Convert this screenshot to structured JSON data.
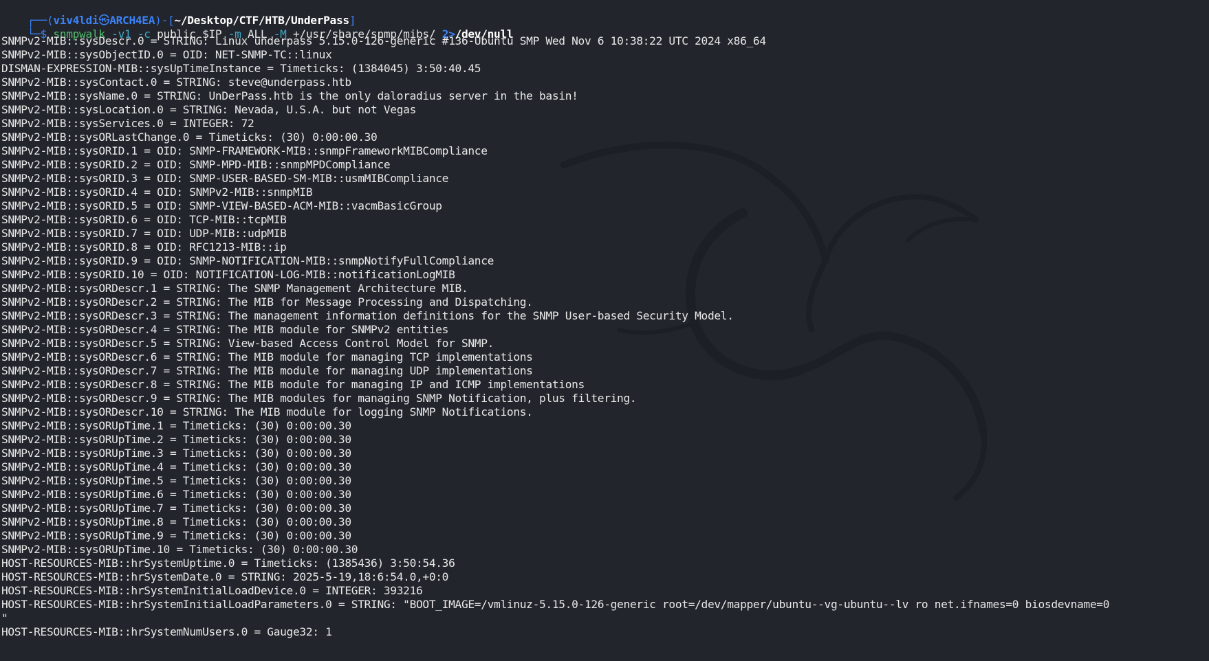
{
  "prompt": {
    "frame_open": "┌──(",
    "user": "viv4ldi",
    "skull": "㉿",
    "host": "ARCH4EA",
    "frame_mid": ")-[",
    "path": "~/Desktop/CTF/HTB/UnderPass",
    "frame_close": "]",
    "line2_prefix": "└─$ ",
    "command": {
      "name": "snmpwalk",
      "parts": [
        {
          "text": " ",
          "kind": "arg"
        },
        {
          "text": "-v1",
          "kind": "flag"
        },
        {
          "text": " ",
          "kind": "arg"
        },
        {
          "text": "-c",
          "kind": "flag"
        },
        {
          "text": " public $IP ",
          "kind": "arg"
        },
        {
          "text": "-m",
          "kind": "flag"
        },
        {
          "text": " ALL ",
          "kind": "arg"
        },
        {
          "text": "-M",
          "kind": "flag"
        },
        {
          "text": " +/usr/share/snmp/mibs/ ",
          "kind": "arg"
        },
        {
          "text": "2>",
          "kind": "redir"
        },
        {
          "text": "/dev/null",
          "kind": "target"
        }
      ]
    }
  },
  "output": [
    "SNMPv2-MIB::sysDescr.0 = STRING: Linux underpass 5.15.0-126-generic #136-Ubuntu SMP Wed Nov 6 10:38:22 UTC 2024 x86_64",
    "SNMPv2-MIB::sysObjectID.0 = OID: NET-SNMP-TC::linux",
    "DISMAN-EXPRESSION-MIB::sysUpTimeInstance = Timeticks: (1384045) 3:50:40.45",
    "SNMPv2-MIB::sysContact.0 = STRING: steve@underpass.htb",
    "SNMPv2-MIB::sysName.0 = STRING: UnDerPass.htb is the only daloradius server in the basin!",
    "SNMPv2-MIB::sysLocation.0 = STRING: Nevada, U.S.A. but not Vegas",
    "SNMPv2-MIB::sysServices.0 = INTEGER: 72",
    "SNMPv2-MIB::sysORLastChange.0 = Timeticks: (30) 0:00:00.30",
    "SNMPv2-MIB::sysORID.1 = OID: SNMP-FRAMEWORK-MIB::snmpFrameworkMIBCompliance",
    "SNMPv2-MIB::sysORID.2 = OID: SNMP-MPD-MIB::snmpMPDCompliance",
    "SNMPv2-MIB::sysORID.3 = OID: SNMP-USER-BASED-SM-MIB::usmMIBCompliance",
    "SNMPv2-MIB::sysORID.4 = OID: SNMPv2-MIB::snmpMIB",
    "SNMPv2-MIB::sysORID.5 = OID: SNMP-VIEW-BASED-ACM-MIB::vacmBasicGroup",
    "SNMPv2-MIB::sysORID.6 = OID: TCP-MIB::tcpMIB",
    "SNMPv2-MIB::sysORID.7 = OID: UDP-MIB::udpMIB",
    "SNMPv2-MIB::sysORID.8 = OID: RFC1213-MIB::ip",
    "SNMPv2-MIB::sysORID.9 = OID: SNMP-NOTIFICATION-MIB::snmpNotifyFullCompliance",
    "SNMPv2-MIB::sysORID.10 = OID: NOTIFICATION-LOG-MIB::notificationLogMIB",
    "SNMPv2-MIB::sysORDescr.1 = STRING: The SNMP Management Architecture MIB.",
    "SNMPv2-MIB::sysORDescr.2 = STRING: The MIB for Message Processing and Dispatching.",
    "SNMPv2-MIB::sysORDescr.3 = STRING: The management information definitions for the SNMP User-based Security Model.",
    "SNMPv2-MIB::sysORDescr.4 = STRING: The MIB module for SNMPv2 entities",
    "SNMPv2-MIB::sysORDescr.5 = STRING: View-based Access Control Model for SNMP.",
    "SNMPv2-MIB::sysORDescr.6 = STRING: The MIB module for managing TCP implementations",
    "SNMPv2-MIB::sysORDescr.7 = STRING: The MIB module for managing UDP implementations",
    "SNMPv2-MIB::sysORDescr.8 = STRING: The MIB module for managing IP and ICMP implementations",
    "SNMPv2-MIB::sysORDescr.9 = STRING: The MIB modules for managing SNMP Notification, plus filtering.",
    "SNMPv2-MIB::sysORDescr.10 = STRING: The MIB module for logging SNMP Notifications.",
    "SNMPv2-MIB::sysORUpTime.1 = Timeticks: (30) 0:00:00.30",
    "SNMPv2-MIB::sysORUpTime.2 = Timeticks: (30) 0:00:00.30",
    "SNMPv2-MIB::sysORUpTime.3 = Timeticks: (30) 0:00:00.30",
    "SNMPv2-MIB::sysORUpTime.4 = Timeticks: (30) 0:00:00.30",
    "SNMPv2-MIB::sysORUpTime.5 = Timeticks: (30) 0:00:00.30",
    "SNMPv2-MIB::sysORUpTime.6 = Timeticks: (30) 0:00:00.30",
    "SNMPv2-MIB::sysORUpTime.7 = Timeticks: (30) 0:00:00.30",
    "SNMPv2-MIB::sysORUpTime.8 = Timeticks: (30) 0:00:00.30",
    "SNMPv2-MIB::sysORUpTime.9 = Timeticks: (30) 0:00:00.30",
    "SNMPv2-MIB::sysORUpTime.10 = Timeticks: (30) 0:00:00.30",
    "HOST-RESOURCES-MIB::hrSystemUptime.0 = Timeticks: (1385436) 3:50:54.36",
    "HOST-RESOURCES-MIB::hrSystemDate.0 = STRING: 2025-5-19,18:6:54.0,+0:0",
    "HOST-RESOURCES-MIB::hrSystemInitialLoadDevice.0 = INTEGER: 393216",
    "HOST-RESOURCES-MIB::hrSystemInitialLoadParameters.0 = STRING: \"BOOT_IMAGE=/vmlinuz-5.15.0-126-generic root=/dev/mapper/ubuntu--vg-ubuntu--lv ro net.ifnames=0 biosdevname=0",
    "\"",
    "HOST-RESOURCES-MIB::hrSystemNumUsers.0 = Gauge32: 1"
  ]
}
